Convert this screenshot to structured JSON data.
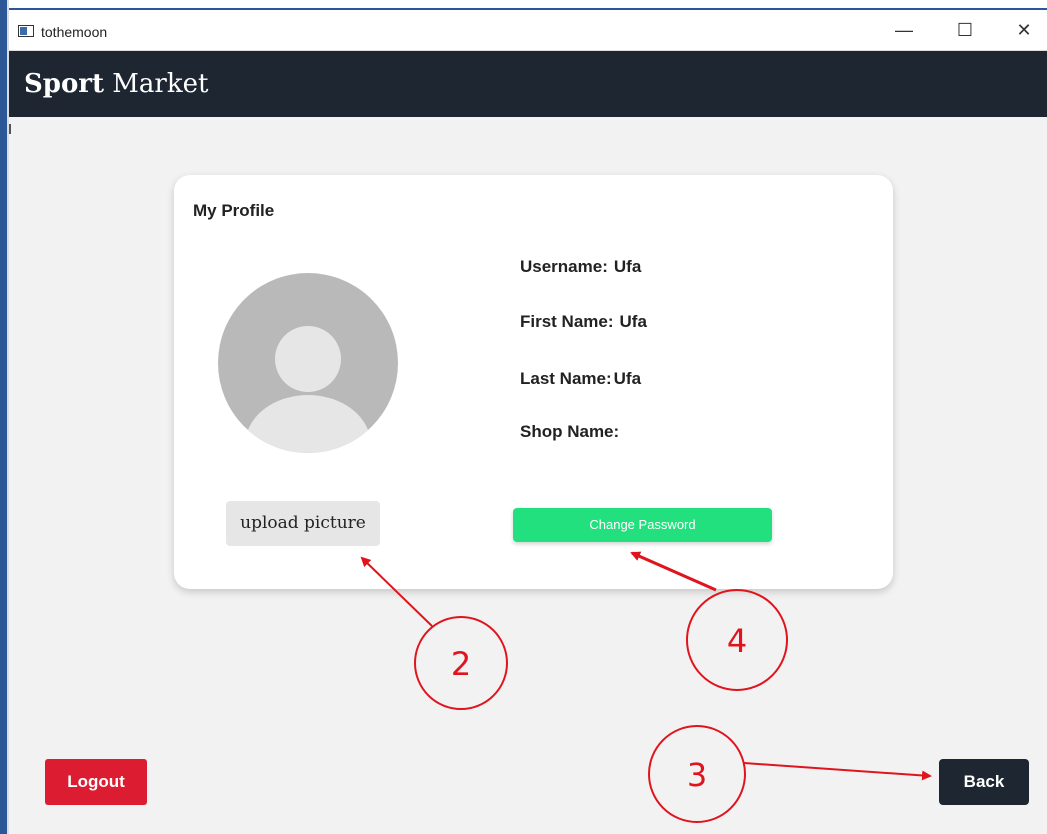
{
  "window": {
    "title": "tothemoon",
    "controls": {
      "minimize": "—",
      "maximize": "☐",
      "close": "✕"
    }
  },
  "header": {
    "brand_bold": "Sport",
    "brand_rest": "Market"
  },
  "profile": {
    "heading": "My Profile",
    "avatar": "user-placeholder-icon",
    "fields": [
      {
        "label": "Username:",
        "value": "Ufa"
      },
      {
        "label": "First Name:",
        "value": "Ufa"
      },
      {
        "label": "Last Name:",
        "value": "Ufa"
      },
      {
        "label": "Shop Name:",
        "value": ""
      }
    ],
    "upload_label": "upload picture",
    "change_password_label": "Change Password"
  },
  "footer": {
    "logout_label": "Logout",
    "back_label": "Back"
  },
  "callouts": [
    "2",
    "3",
    "4"
  ],
  "colors": {
    "appbar": "#1e2631",
    "change_password": "#22e07d",
    "logout": "#dc1c31",
    "annotation": "#e0141d"
  }
}
